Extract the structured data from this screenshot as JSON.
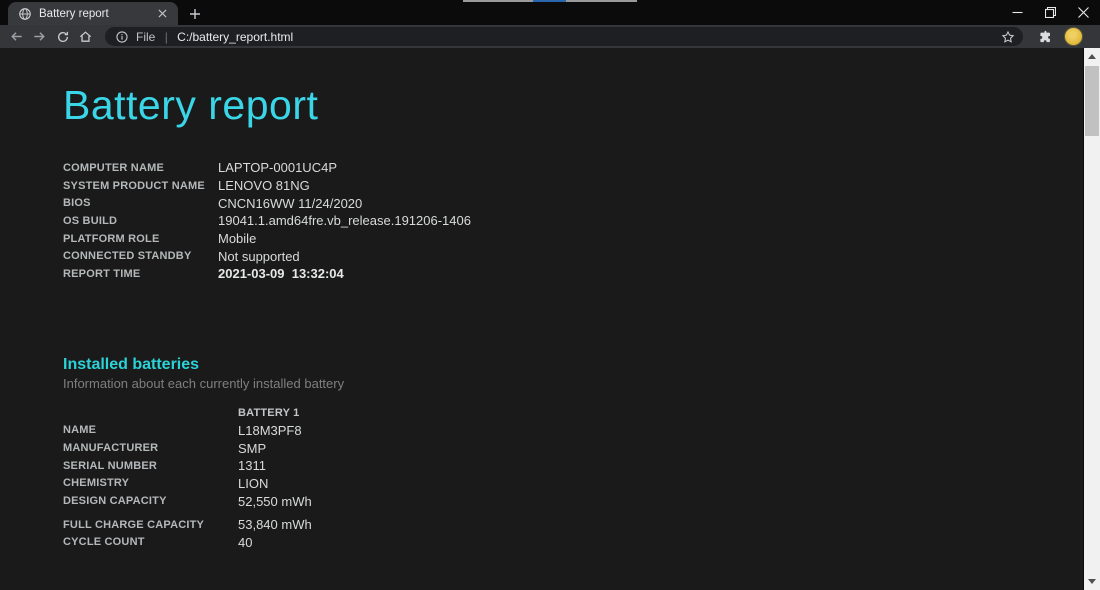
{
  "browser": {
    "tab_title": "Battery report",
    "address": {
      "scheme": "File",
      "separator": "|",
      "url": "C:/battery_report.html"
    },
    "icons": {
      "favicon": "globe-icon",
      "tab_close": "close-icon",
      "new_tab": "plus-icon",
      "nav": [
        "back-arrow-icon",
        "forward-arrow-icon",
        "reload-icon",
        "home-icon"
      ],
      "omnibox_left": "info-icon",
      "omnibox_right": "bookmark-star-icon",
      "toolbar_right": [
        "extensions-puzzle-icon",
        "profile-avatar",
        "menu-dots-icon"
      ],
      "window": [
        "minimize-icon",
        "restore-icon",
        "close-icon"
      ]
    }
  },
  "page": {
    "title": "Battery report",
    "system_info": [
      {
        "label": "COMPUTER NAME",
        "value": "LAPTOP-0001UC4P"
      },
      {
        "label": "SYSTEM PRODUCT NAME",
        "value": "LENOVO 81NG"
      },
      {
        "label": "BIOS",
        "value": "CNCN16WW 11/24/2020"
      },
      {
        "label": "OS BUILD",
        "value": "19041.1.amd64fre.vb_release.191206-1406"
      },
      {
        "label": "PLATFORM ROLE",
        "value": "Mobile"
      },
      {
        "label": "CONNECTED STANDBY",
        "value": "Not supported"
      },
      {
        "label": "REPORT TIME",
        "value": "2021-03-09  13:32:04"
      }
    ],
    "installed_batteries": {
      "heading": "Installed batteries",
      "subtitle": "Information about each currently installed battery",
      "column_header": "BATTERY 1",
      "rows": [
        {
          "label": "NAME",
          "value": "L18M3PF8"
        },
        {
          "label": "MANUFACTURER",
          "value": "SMP"
        },
        {
          "label": "SERIAL NUMBER",
          "value": "1311"
        },
        {
          "label": "CHEMISTRY",
          "value": "LION"
        },
        {
          "label": "DESIGN CAPACITY",
          "value": "52,550 mWh"
        },
        {
          "label": "FULL CHARGE CAPACITY",
          "value": "53,840 mWh"
        },
        {
          "label": "CYCLE COUNT",
          "value": "40"
        }
      ]
    }
  },
  "colors": {
    "page_bg": "#1a1a1a",
    "title_cyan": "#3ad5e6",
    "heading_cyan": "#2bd2d8",
    "label_gray": "#b5b8ba",
    "value_gray": "#d8dadb",
    "subtitle_gray": "#7d7f80",
    "tabbar_bg": "#0b0b0c",
    "toolbar_bg": "#35363a",
    "omnibox_bg": "#1e1f22",
    "scrollbar_track": "#f1f1f1",
    "scrollbar_thumb": "#c1c1c1",
    "avatar_gold": "#e0b73a",
    "artifact_gray": "#9a9a9a",
    "artifact_blue": "#2a66ad"
  }
}
